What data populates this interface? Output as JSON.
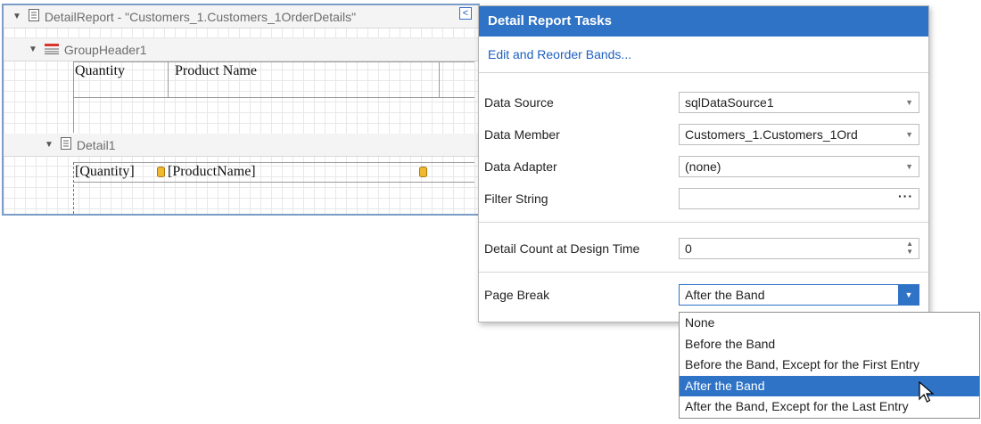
{
  "designer": {
    "detail_report_title": "DetailReport - \"Customers_1.Customers_1OrderDetails\"",
    "group_header_title": "GroupHeader1",
    "detail_title": "Detail1",
    "header_cells": [
      "Quantity",
      "Product Name"
    ],
    "detail_cells": [
      "[Quantity]",
      "[ProductName]"
    ],
    "collapse_glyph": "<"
  },
  "tasks_panel": {
    "title": "Detail Report Tasks",
    "link": "Edit and Reorder Bands...",
    "rows": {
      "data_source": {
        "label": "Data Source",
        "value": "sqlDataSource1"
      },
      "data_member": {
        "label": "Data Member",
        "value": "Customers_1.Customers_1Ord"
      },
      "data_adapter": {
        "label": "Data Adapter",
        "value": "(none)"
      },
      "filter_string": {
        "label": "Filter String",
        "value": ""
      },
      "detail_count": {
        "label": "Detail Count at Design Time",
        "value": "0"
      },
      "page_break": {
        "label": "Page Break",
        "value": "After the Band"
      }
    }
  },
  "page_break_dropdown": {
    "options": [
      "None",
      "Before the Band",
      "Before the Band, Except for the First Entry",
      "After the Band",
      "After the Band, Except for the Last Entry"
    ],
    "selected_index": 3
  },
  "icons": {
    "report": "report-icon",
    "group_header": "group-header-icon",
    "detail": "detail-band-icon",
    "database": "database-icon",
    "cursor": "mouse-cursor"
  },
  "colors": {
    "accent": "#2f73c6",
    "border": "#7a9cc6"
  }
}
